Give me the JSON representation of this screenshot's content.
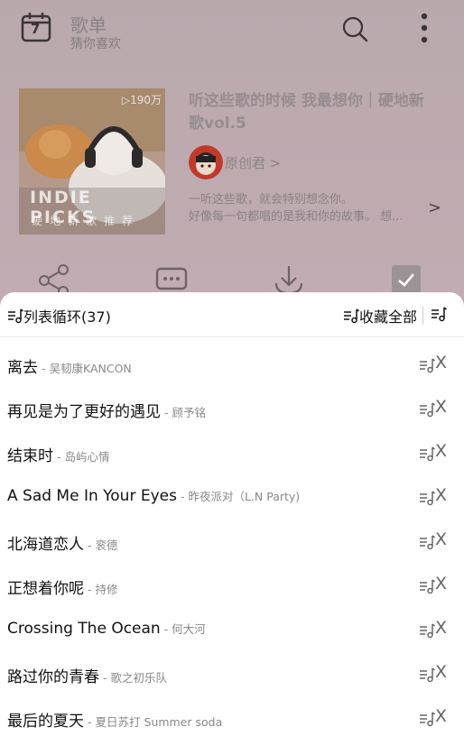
{
  "header": {
    "title": "歌单",
    "subtitle": "猜你喜欢",
    "calendar_day": "7"
  },
  "playlist": {
    "play_count": "▷190万",
    "cover_title": "INDIE PICKS",
    "cover_subtitle": "硬地新歌推荐",
    "title": "听这些歌的时候 我最想你｜硬地新歌vol.5",
    "creator": "原创君 >",
    "desc_line1": "一听这些歌，就会特别想念你。",
    "desc_line2": "好像每一句都唱的是我和你的故事。 想...",
    "desc_arrow": ">"
  },
  "sheet": {
    "mode_label": "列表循环(37)",
    "collect_label": "收藏全部"
  },
  "songs": [
    {
      "title": "离去",
      "artist": "- 吴韧康KANCON"
    },
    {
      "title": "再见是为了更好的遇见",
      "artist": "- 顾予铭"
    },
    {
      "title": "结束时",
      "artist": "- 岛屿心情"
    },
    {
      "title": "A Sad Me In Your Eyes",
      "artist": "- 昨夜派对（L.N Party)"
    },
    {
      "title": "北海道恋人",
      "artist": "- 衮德"
    },
    {
      "title": "正想着你呢",
      "artist": "- 持修"
    },
    {
      "title": "Crossing The Ocean",
      "artist": "- 何大河"
    },
    {
      "title": "路过你的青春",
      "artist": "- 歌之初乐队"
    },
    {
      "title": "最后的夏天",
      "artist": "- 夏日苏打 Summer soda"
    }
  ],
  "remove_label": "X",
  "colors": {
    "overlay_bg": "#bba8ad",
    "sheet_bg": "#ffffff",
    "text": "#111111",
    "muted": "#888888"
  },
  "icons": [
    "calendar-icon",
    "search-icon",
    "more-vertical-icon",
    "share-icon",
    "comment-icon",
    "download-icon",
    "check-icon",
    "repeat-list-icon",
    "collect-icon",
    "queue-icon"
  ]
}
